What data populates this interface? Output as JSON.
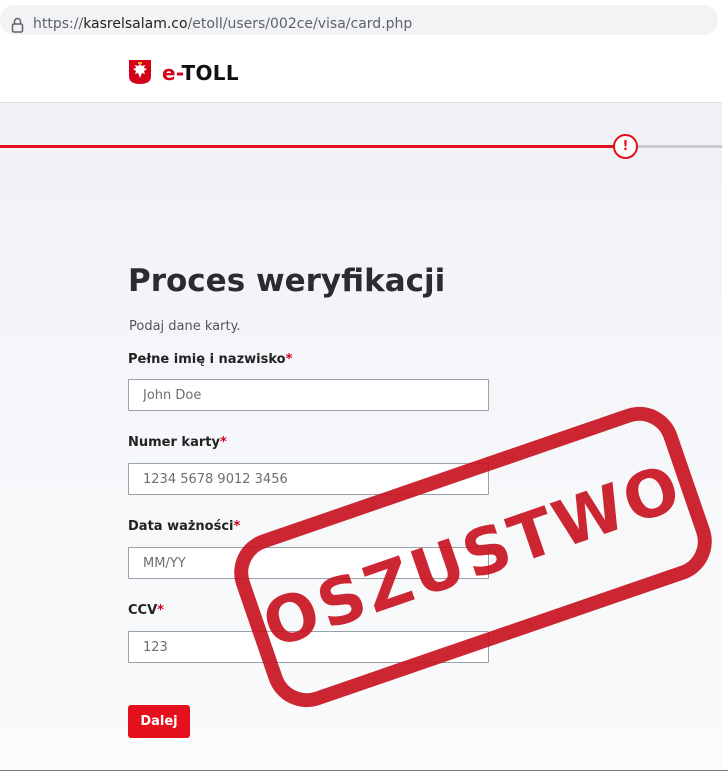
{
  "browser": {
    "url_scheme": "https://",
    "url_host": "kasrelsalam.co",
    "url_path": "/etoll/users/002ce/visa/card.php"
  },
  "header": {
    "brand_prefix": "e-",
    "brand_name": "TOLL"
  },
  "progress": {
    "alert_symbol": "!",
    "completed_fraction": 0.85
  },
  "form": {
    "title": "Proces weryfikacji",
    "subtitle": "Podaj dane karty.",
    "fields": [
      {
        "label": "Pełne imię i nazwisko",
        "required_mark": "*",
        "placeholder": "John Doe"
      },
      {
        "label": "Numer karty",
        "required_mark": "*",
        "placeholder": "1234 5678 9012 3456"
      },
      {
        "label": "Data ważności",
        "required_mark": "*",
        "placeholder": "MM/YY"
      },
      {
        "label": "CCV",
        "required_mark": "*",
        "placeholder": "123"
      }
    ],
    "submit_label": "Dalej"
  },
  "stamp": {
    "text": "OSZUSTWO"
  },
  "colors": {
    "accent": "#e4111c",
    "stamp": "#c8101d"
  }
}
